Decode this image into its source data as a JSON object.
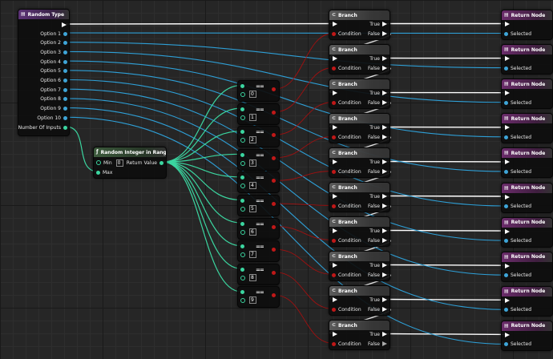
{
  "random_type": {
    "title": "Random Type",
    "icon": "enum-icon",
    "header_color": "#5c3376",
    "options": [
      "Option 1",
      "Option 2",
      "Option 3",
      "Option 4",
      "Option 5",
      "Option 6",
      "Option 7",
      "Option 8",
      "Option 9",
      "Option 10"
    ],
    "num_inputs_label": "Number Of Inputs"
  },
  "random_int": {
    "title": "Random Integer in Range",
    "icon": "function-icon",
    "header_color": "#3c5a3c",
    "min_label": "Min",
    "min_value": "0",
    "max_label": "Max",
    "return_label": "Return Value"
  },
  "equals_nodes": {
    "symbol": "==",
    "values": [
      "0",
      "1",
      "2",
      "3",
      "4",
      "5",
      "6",
      "7",
      "8",
      "9"
    ]
  },
  "branch": {
    "title": "Branch",
    "icon": "branch-icon",
    "header_color": "#5a5a5a",
    "condition_label": "Condition",
    "true_label": "True",
    "false_label": "False",
    "count": 10
  },
  "return_node": {
    "title": "Return Node",
    "icon": "return-icon",
    "header_color": "#6a2c6a",
    "selected_label": "Selected",
    "count": 10
  },
  "colors": {
    "background": "#262626",
    "exec_wire": "#ffffff",
    "enum_wire": "#2e9fd6",
    "int_wire": "#3bd6a0",
    "bool_wire": "#a01010"
  }
}
